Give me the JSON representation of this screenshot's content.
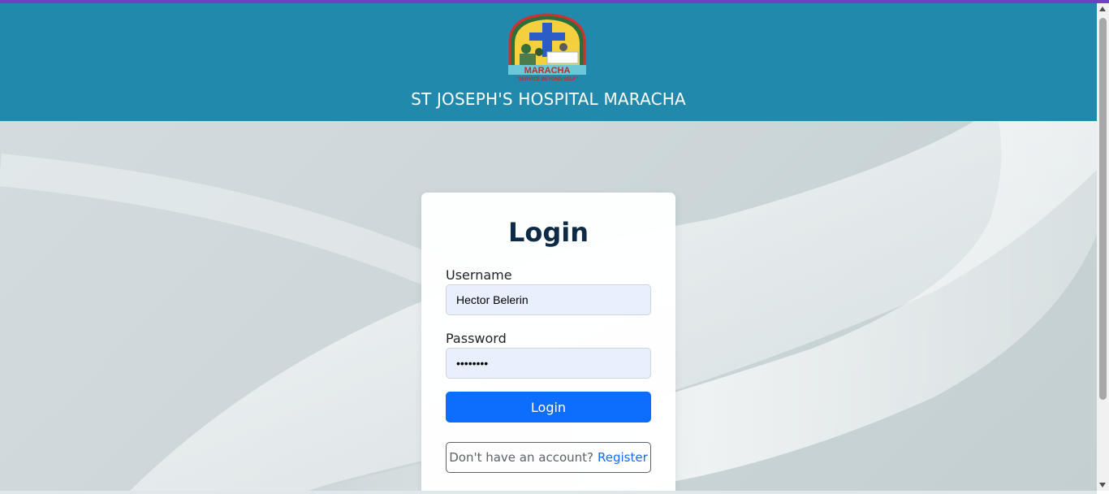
{
  "header": {
    "hospital_name": "ST JOSEPH'S HOSPITAL MARACHA",
    "logo_icon": "hospital-logo",
    "logo_text_arc": "ST JOSEPH'S HOSPITAL",
    "logo_text_main": "MARACHA",
    "logo_motto": "\"SERVICE BEYOND SELF\"",
    "header_color": "#2189ab"
  },
  "login_form": {
    "title": "Login",
    "username_label": "Username",
    "username_value": "Hector Belerin",
    "password_label": "Password",
    "password_value": "••••••••",
    "login_button": "Login",
    "register_prompt": "Don't have an account?",
    "register_link": "Register",
    "button_color": "#0d6efd"
  }
}
